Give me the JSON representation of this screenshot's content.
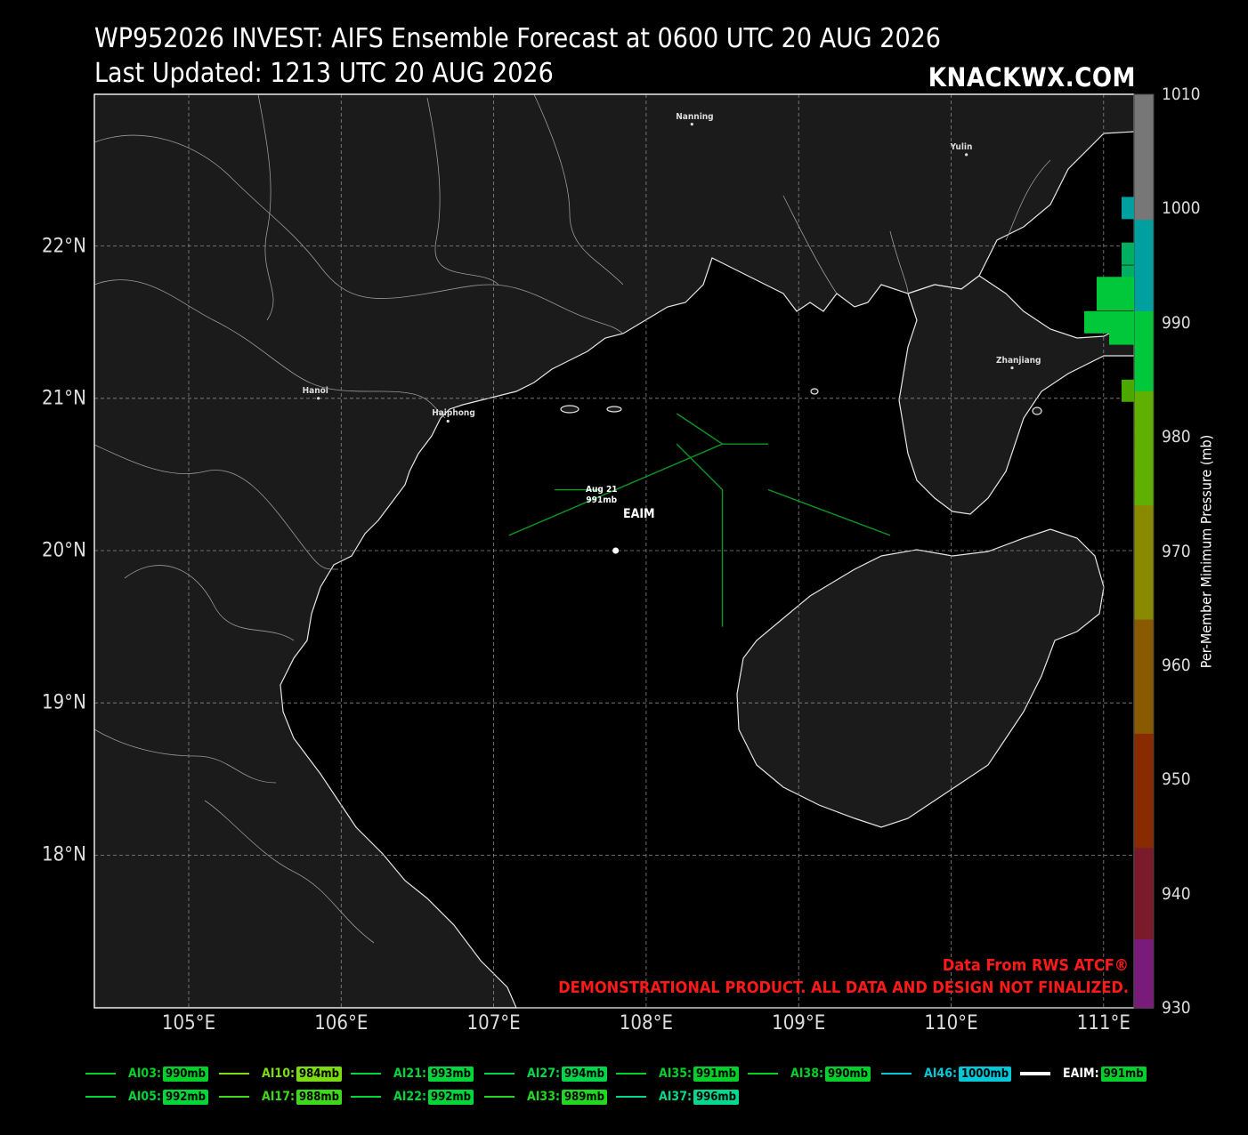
{
  "title_line1": "WP952026 INVEST: AIFS Ensemble Forecast at 0600 UTC 20 AUG 2026",
  "title_line2": "Last Updated: 1213 UTC 20 AUG 2026",
  "brand": "KNACKWX.COM",
  "credit_line1": "Data From RWS ATCF®",
  "credit_line2": "DEMONSTRATIONAL PRODUCT. ALL DATA AND DESIGN NOT FINALIZED.",
  "colorbar": {
    "label": "Per-Member Minimum Pressure (mb)",
    "ticks": [
      "1010",
      "1000",
      "990",
      "980",
      "970",
      "960",
      "950",
      "940",
      "930"
    ],
    "range": [
      930,
      1010
    ],
    "histogram": [
      {
        "mb": 1000,
        "members": 1
      },
      {
        "mb": 996,
        "members": 1
      },
      {
        "mb": 994,
        "members": 1
      },
      {
        "mb": 993,
        "members": 3
      },
      {
        "mb": 992,
        "members": 3
      },
      {
        "mb": 990,
        "members": 4
      },
      {
        "mb": 989,
        "members": 2
      },
      {
        "mb": 984,
        "members": 1
      }
    ]
  },
  "axes": {
    "lat_labels": [
      "22°N",
      "21°N",
      "20°N",
      "19°N",
      "18°N"
    ],
    "lon_labels": [
      "105°E",
      "106°E",
      "107°E",
      "108°E",
      "109°E",
      "110°E",
      "111°E"
    ],
    "lat_values": [
      22,
      21,
      20,
      19,
      18
    ],
    "lon_values": [
      105,
      106,
      107,
      108,
      109,
      110,
      111
    ]
  },
  "cities": [
    {
      "name": "Nanning",
      "lon": 108.3,
      "lat": 22.8
    },
    {
      "name": "Yulin",
      "lon": 110.1,
      "lat": 22.6
    },
    {
      "name": "Hanoi",
      "lon": 105.85,
      "lat": 21.0
    },
    {
      "name": "Haiphong",
      "lon": 106.7,
      "lat": 20.85
    },
    {
      "name": "Zhanjiang",
      "lon": 110.4,
      "lat": 21.2
    }
  ],
  "track_label": {
    "date": "Aug 21",
    "pressure": "991mb"
  },
  "eaim": {
    "label": "EAIM",
    "lon": 107.8,
    "lat": 20.0
  },
  "tracks": [
    {
      "lon": [
        107.1,
        108.5,
        108.8
      ],
      "lat": [
        20.1,
        20.7,
        20.7
      ]
    },
    {
      "lon": [
        108.2,
        108.5
      ],
      "lat": [
        20.9,
        20.7
      ]
    },
    {
      "lon": [
        108.2,
        108.5,
        108.5
      ],
      "lat": [
        20.7,
        20.4,
        19.5
      ]
    },
    {
      "lon": [
        108.8,
        109.6
      ],
      "lat": [
        20.4,
        20.1
      ]
    },
    {
      "lon": [
        107.4,
        107.7
      ],
      "lat": [
        20.4,
        20.4
      ]
    }
  ],
  "legend": [
    {
      "name": "AI03:",
      "value": "990mb",
      "color": "#00d12a"
    },
    {
      "name": "AI10:",
      "value": "984mb",
      "color": "#7bdc12"
    },
    {
      "name": "AI21:",
      "value": "993mb",
      "color": "#00d63c"
    },
    {
      "name": "AI27:",
      "value": "994mb",
      "color": "#00d64a"
    },
    {
      "name": "AI35:",
      "value": "991mb",
      "color": "#00d12a"
    },
    {
      "name": "AI38:",
      "value": "990mb",
      "color": "#00d12a"
    },
    {
      "name": "AI46:",
      "value": "1000mb",
      "color": "#00c8d8"
    },
    {
      "name": "EAIM:",
      "value": "991mb",
      "color": "#00d12a"
    },
    {
      "name": "AI05:",
      "value": "992mb",
      "color": "#00d637"
    },
    {
      "name": "AI17:",
      "value": "988mb",
      "color": "#3ed81a"
    },
    {
      "name": "AI22:",
      "value": "992mb",
      "color": "#00d637"
    },
    {
      "name": "AI33:",
      "value": "989mb",
      "color": "#21d820"
    },
    {
      "name": "AI37:",
      "value": "996mb",
      "color": "#00d890"
    }
  ]
}
